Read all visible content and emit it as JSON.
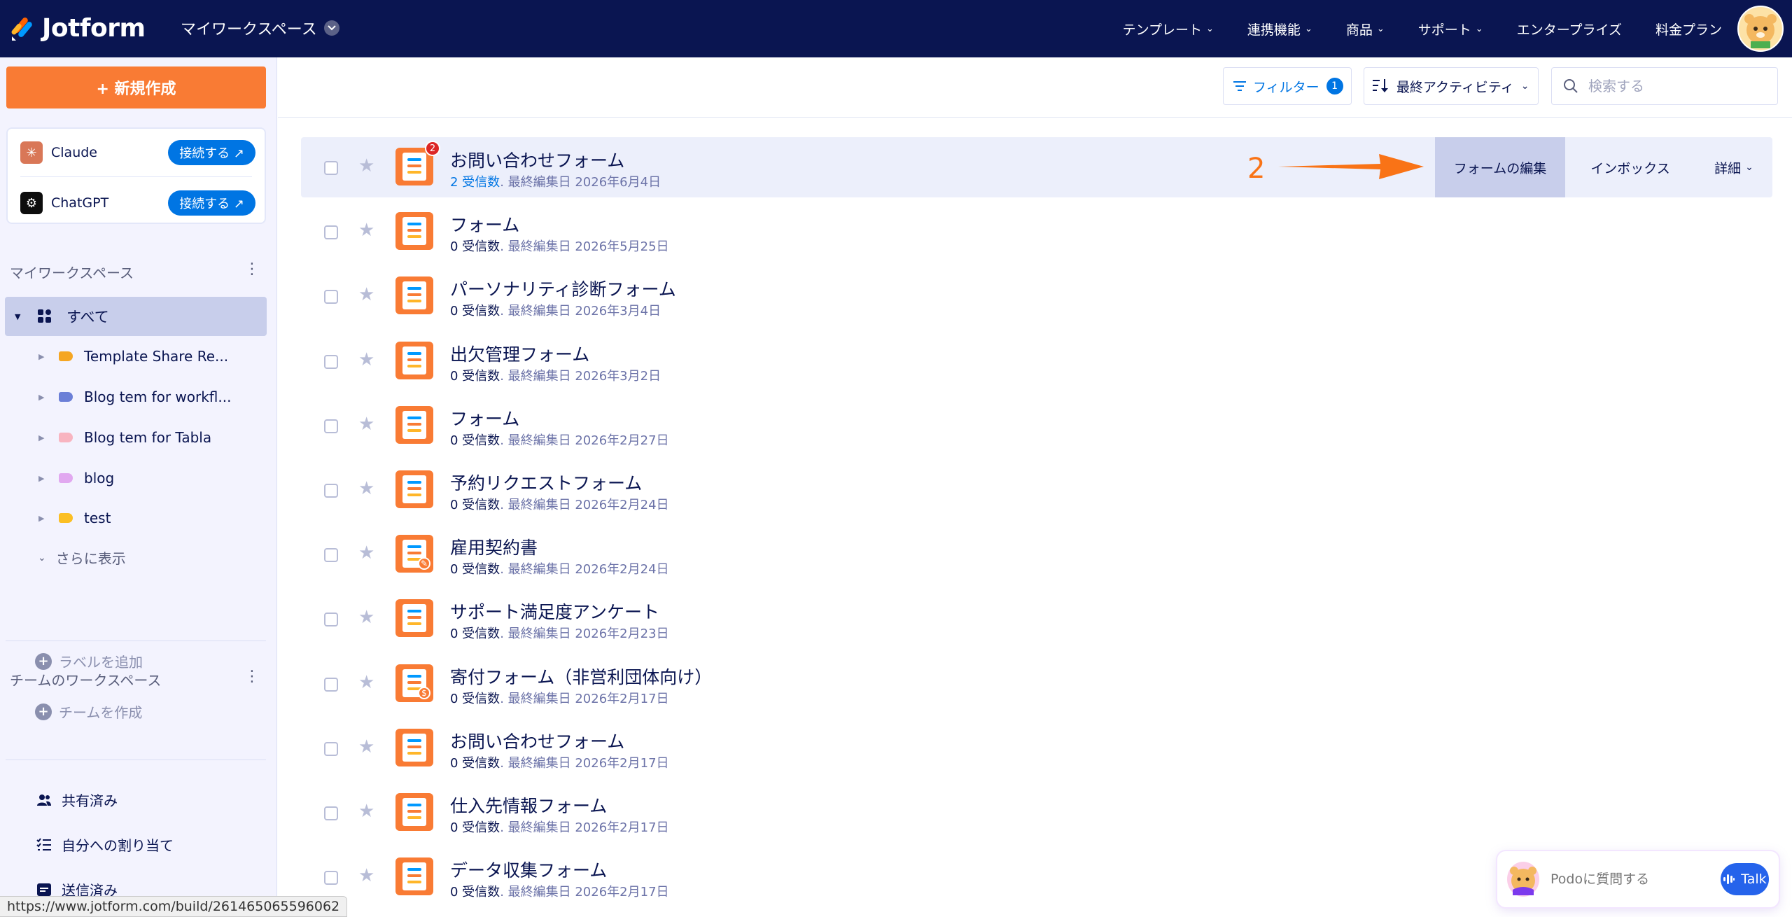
{
  "brand": {
    "name": "Jotform"
  },
  "topbar": {
    "workspace": "マイワークスペース",
    "nav": [
      {
        "label": "テンプレート",
        "chevron": true
      },
      {
        "label": "連携機能",
        "chevron": true
      },
      {
        "label": "商品",
        "chevron": true
      },
      {
        "label": "サポート",
        "chevron": true
      },
      {
        "label": "エンタープライズ",
        "chevron": false
      },
      {
        "label": "料金プラン",
        "chevron": false
      }
    ]
  },
  "sidebar": {
    "create_label": "+ 新規作成",
    "ai": [
      {
        "name": "Claude",
        "button": "接続する ↗",
        "color": "#d97757"
      },
      {
        "name": "ChatGPT",
        "button": "接続する ↗",
        "color": "#0d0d0d"
      }
    ],
    "my_workspace_title": "マイワークスペース",
    "all_label": "すべて",
    "folders": [
      {
        "label": "Template Share Re...",
        "color": "#f5a623"
      },
      {
        "label": "Blog tem for workfl...",
        "color": "#6b7fd7"
      },
      {
        "label": "Blog tem for Tabla",
        "color": "#f8b4c0"
      },
      {
        "label": "blog",
        "color": "#e1a8f0"
      },
      {
        "label": "test",
        "color": "#fbbf24"
      }
    ],
    "show_more": "さらに表示",
    "add_label": "ラベルを追加",
    "team_title": "チームのワークスペース",
    "create_team": "チームを作成",
    "links": [
      {
        "label": "共有済み",
        "icon": "people-icon"
      },
      {
        "label": "自分への割り当て",
        "icon": "checklist-icon"
      },
      {
        "label": "送信済み",
        "icon": "sent-icon"
      }
    ]
  },
  "status_url": "https://www.jotform.com/build/261465065596062",
  "toolbar": {
    "filter_label": "フィルター",
    "filter_count": "1",
    "sort_label": "最終アクティビティ",
    "search_placeholder": "検索する"
  },
  "forms": [
    {
      "title": "お問い合わせフォーム",
      "count": "2 受信数",
      "meta": ". 最終編集日 2026年6月4日",
      "badge": "2",
      "highlight": true,
      "extra": ""
    },
    {
      "title": "フォーム",
      "count": "0 受信数",
      "meta": ". 最終編集日 2026年5月25日",
      "badge": "",
      "highlight": false,
      "extra": ""
    },
    {
      "title": "パーソナリティ診断フォーム",
      "count": "0 受信数",
      "meta": ". 最終編集日 2026年3月4日",
      "badge": "",
      "highlight": false,
      "extra": ""
    },
    {
      "title": "出欠管理フォーム",
      "count": "0 受信数",
      "meta": ". 最終編集日 2026年3月2日",
      "badge": "",
      "highlight": false,
      "extra": ""
    },
    {
      "title": "フォーム",
      "count": "0 受信数",
      "meta": ". 最終編集日 2026年2月27日",
      "badge": "",
      "highlight": false,
      "extra": ""
    },
    {
      "title": "予約リクエストフォーム",
      "count": "0 受信数",
      "meta": ". 最終編集日 2026年2月24日",
      "badge": "",
      "highlight": false,
      "extra": ""
    },
    {
      "title": "雇用契約書",
      "count": "0 受信数",
      "meta": ". 最終編集日 2026年2月24日",
      "badge": "",
      "highlight": false,
      "extra": "✎"
    },
    {
      "title": "サポート満足度アンケート",
      "count": "0 受信数",
      "meta": ". 最終編集日 2026年2月23日",
      "badge": "",
      "highlight": false,
      "extra": ""
    },
    {
      "title": "寄付フォーム（非営利団体向け）",
      "count": "0 受信数",
      "meta": ". 最終編集日 2026年2月17日",
      "badge": "",
      "highlight": false,
      "extra": "$"
    },
    {
      "title": "お問い合わせフォーム",
      "count": "0 受信数",
      "meta": ". 最終編集日 2026年2月17日",
      "badge": "",
      "highlight": false,
      "extra": ""
    },
    {
      "title": "仕入先情報フォーム",
      "count": "0 受信数",
      "meta": ". 最終編集日 2026年2月17日",
      "badge": "",
      "highlight": false,
      "extra": ""
    },
    {
      "title": "データ収集フォーム",
      "count": "0 受信数",
      "meta": ". 最終編集日 2026年2月17日",
      "badge": "",
      "highlight": false,
      "extra": ""
    }
  ],
  "row_actions": {
    "edit": "フォームの編集",
    "inbox": "インボックス",
    "more": "詳細"
  },
  "annotation": {
    "number": "2",
    "color": "#f97316"
  },
  "podo": {
    "placeholder": "Podoに質問する",
    "talk": "Talk"
  },
  "colors": {
    "nav_bg": "#0a1551",
    "accent": "#f97b34",
    "primary": "#0075e3",
    "sidebar_bg": "#f3f3fe"
  }
}
